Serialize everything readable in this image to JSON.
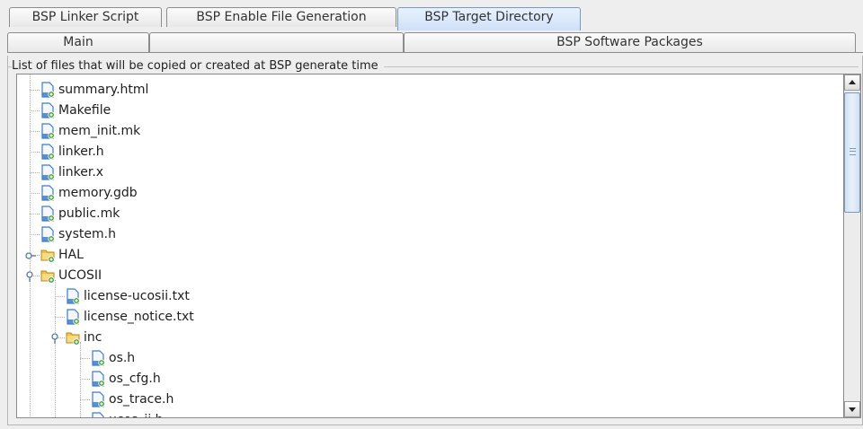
{
  "tabs_row1": [
    "BSP Linker Script",
    "BSP Enable File Generation",
    "BSP Target Directory"
  ],
  "tabs_row1_selected": "BSP Target Directory",
  "tabs_row2": [
    "Main",
    "",
    "BSP Software Packages"
  ],
  "group_title": "List of files that will be copied or created at BSP generate time",
  "tree": [
    {
      "label": "summary.html",
      "type": "file",
      "depth": 0
    },
    {
      "label": "Makefile",
      "type": "file",
      "depth": 0
    },
    {
      "label": "mem_init.mk",
      "type": "file",
      "depth": 0
    },
    {
      "label": "linker.h",
      "type": "file",
      "depth": 0
    },
    {
      "label": "linker.x",
      "type": "file",
      "depth": 0
    },
    {
      "label": "memory.gdb",
      "type": "file",
      "depth": 0
    },
    {
      "label": "public.mk",
      "type": "file",
      "depth": 0
    },
    {
      "label": "system.h",
      "type": "file",
      "depth": 0
    },
    {
      "label": "HAL",
      "type": "folder",
      "depth": 0,
      "expanded": false
    },
    {
      "label": "UCOSII",
      "type": "folder",
      "depth": 0,
      "expanded": true
    },
    {
      "label": "license-ucosii.txt",
      "type": "file",
      "depth": 1
    },
    {
      "label": "license_notice.txt",
      "type": "file",
      "depth": 1
    },
    {
      "label": "inc",
      "type": "folder",
      "depth": 1,
      "expanded": true
    },
    {
      "label": "os.h",
      "type": "file",
      "depth": 2
    },
    {
      "label": "os_cfg.h",
      "type": "file",
      "depth": 2
    },
    {
      "label": "os_trace.h",
      "type": "file",
      "depth": 2
    },
    {
      "label": "ucos_ii.h",
      "type": "file",
      "depth": 2
    }
  ],
  "colors": {
    "selected_tab": "#cfe0f7",
    "file_icon": "#3e7cc9",
    "folder_icon": "#f0c24a",
    "add_badge": "#3f9c2f"
  },
  "icons": {
    "file": "file-add-icon",
    "folder": "folder-add-icon",
    "collapsed": "tree-collapsed-icon",
    "expanded": "tree-expanded-icon",
    "scroll_up": "arrow-up-icon",
    "scroll_down": "arrow-down-icon"
  }
}
